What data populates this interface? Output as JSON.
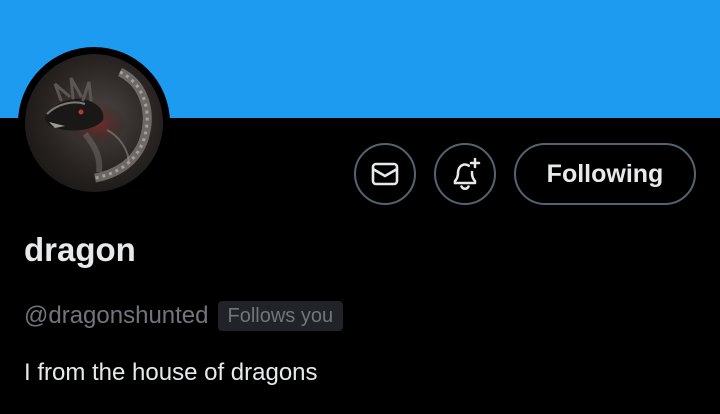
{
  "theme": {
    "banner_color": "#1d9bf0",
    "background": "#000000",
    "text_primary": "#e7e9ea",
    "text_secondary": "#71767b",
    "border": "#536471",
    "badge_bg": "#202327"
  },
  "profile": {
    "display_name": "dragon",
    "handle": "@dragonshunted",
    "follows_you_label": "Follows you",
    "bio": "I from the house of dragons",
    "avatar": "dragon-avatar-image"
  },
  "actions": {
    "message_icon": "mail-icon",
    "notify_icon": "bell-plus-icon",
    "following_label": "Following"
  }
}
